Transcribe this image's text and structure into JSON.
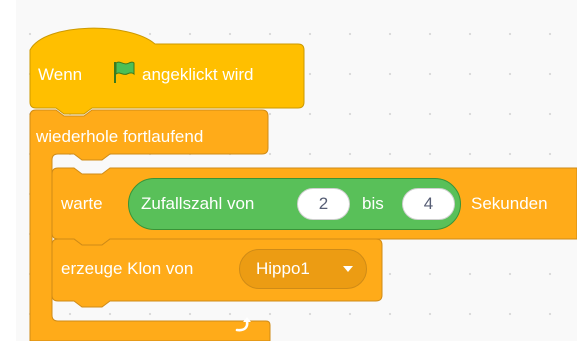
{
  "script": {
    "hat": {
      "prefix": "Wenn",
      "flag_icon": "green-flag-icon",
      "suffix": "angeklickt wird",
      "color": "#ffbf00"
    },
    "forever": {
      "label": "wiederhole fortlaufend",
      "loop_icon": "loop-arrow-icon",
      "color": "#ffab19"
    },
    "wait": {
      "prefix": "warte",
      "random": {
        "label": "Zufallszahl von",
        "from": "2",
        "between": "bis",
        "to": "4",
        "color": "#59c059"
      },
      "suffix": "Sekunden"
    },
    "clone": {
      "label": "erzeuge Klon von",
      "target": "Hippo1",
      "dropdown_icon": "caret-down-icon"
    }
  }
}
